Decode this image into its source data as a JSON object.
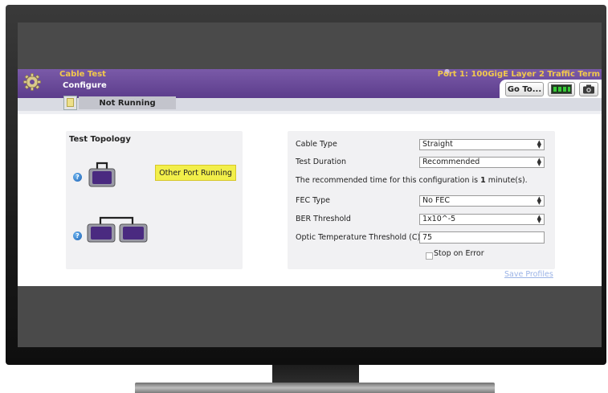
{
  "header": {
    "title": "Cable Test",
    "subtitle": "Configure",
    "port": "Port 1: 100GigE Layer 2 Traffic Term",
    "goto_label": "Go To..."
  },
  "status": {
    "label": "Not Running"
  },
  "topology": {
    "title": "Test Topology",
    "other_port_label": "Other Port Running",
    "help_glyph": "?"
  },
  "config": {
    "cable_type": {
      "label": "Cable Type",
      "value": "Straight"
    },
    "test_duration": {
      "label": "Test Duration",
      "value": "Recommended"
    },
    "recommend_pre": "The recommended time for this configuration is ",
    "recommend_value": "1",
    "recommend_post": " minute(s).",
    "fec_type": {
      "label": "FEC Type",
      "value": "No FEC"
    },
    "ber_threshold": {
      "label": "BER Threshold",
      "value": "1x10^-5"
    },
    "optic_temp": {
      "label": "Optic Temperature Threshold (C)",
      "value": "75"
    },
    "stop_on_error": {
      "label": "Stop on Error",
      "checked": false
    }
  },
  "links": {
    "save_profiles": "Save Profiles"
  },
  "colors": {
    "header_purple": "#5c3d8c",
    "title_gold": "#f2c94c",
    "other_port_yellow": "#f2ef4a",
    "device_purple": "#4a2a80"
  },
  "icons": [
    "gear-icon",
    "port-status-icon",
    "snapshot-icon",
    "help-icon",
    "device-icon",
    "loopback-device-icon"
  ]
}
